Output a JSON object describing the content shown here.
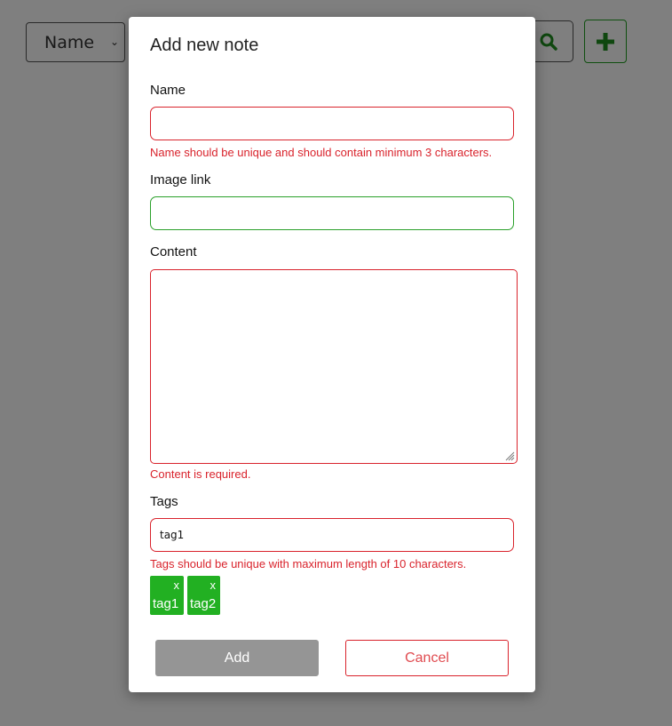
{
  "background": {
    "sort_select_value": "Name",
    "search_icon": "search-icon",
    "add_icon": "plus-icon"
  },
  "modal": {
    "title": "Add new note",
    "name": {
      "label": "Name",
      "value": "",
      "error": "Name should be unique and should contain minimum 3 characters."
    },
    "image_link": {
      "label": "Image link",
      "value": ""
    },
    "content": {
      "label": "Content",
      "value": "",
      "error": "Content is required."
    },
    "tags": {
      "label": "Tags",
      "value": "tag1",
      "error": "Tags should be unique with maximum length of 10 characters.",
      "chips": [
        {
          "label": "tag1",
          "remove": "x"
        },
        {
          "label": "tag2",
          "remove": "x"
        }
      ]
    },
    "add_label": "Add",
    "cancel_label": "Cancel"
  },
  "colors": {
    "error": "#d9232c",
    "valid": "#2aa02a",
    "tag_bg": "#22b022",
    "add_disabled": "#959595"
  }
}
